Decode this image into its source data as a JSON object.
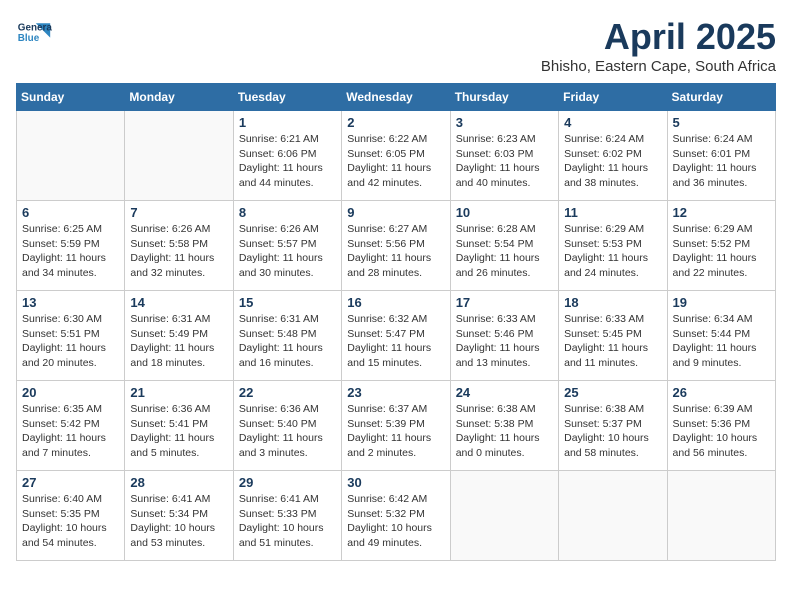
{
  "header": {
    "logo_general": "General",
    "logo_blue": "Blue",
    "month_title": "April 2025",
    "location": "Bhisho, Eastern Cape, South Africa"
  },
  "days_of_week": [
    "Sunday",
    "Monday",
    "Tuesday",
    "Wednesday",
    "Thursday",
    "Friday",
    "Saturday"
  ],
  "weeks": [
    [
      {
        "day": "",
        "info": ""
      },
      {
        "day": "",
        "info": ""
      },
      {
        "day": "1",
        "info": "Sunrise: 6:21 AM\nSunset: 6:06 PM\nDaylight: 11 hours and 44 minutes."
      },
      {
        "day": "2",
        "info": "Sunrise: 6:22 AM\nSunset: 6:05 PM\nDaylight: 11 hours and 42 minutes."
      },
      {
        "day": "3",
        "info": "Sunrise: 6:23 AM\nSunset: 6:03 PM\nDaylight: 11 hours and 40 minutes."
      },
      {
        "day": "4",
        "info": "Sunrise: 6:24 AM\nSunset: 6:02 PM\nDaylight: 11 hours and 38 minutes."
      },
      {
        "day": "5",
        "info": "Sunrise: 6:24 AM\nSunset: 6:01 PM\nDaylight: 11 hours and 36 minutes."
      }
    ],
    [
      {
        "day": "6",
        "info": "Sunrise: 6:25 AM\nSunset: 5:59 PM\nDaylight: 11 hours and 34 minutes."
      },
      {
        "day": "7",
        "info": "Sunrise: 6:26 AM\nSunset: 5:58 PM\nDaylight: 11 hours and 32 minutes."
      },
      {
        "day": "8",
        "info": "Sunrise: 6:26 AM\nSunset: 5:57 PM\nDaylight: 11 hours and 30 minutes."
      },
      {
        "day": "9",
        "info": "Sunrise: 6:27 AM\nSunset: 5:56 PM\nDaylight: 11 hours and 28 minutes."
      },
      {
        "day": "10",
        "info": "Sunrise: 6:28 AM\nSunset: 5:54 PM\nDaylight: 11 hours and 26 minutes."
      },
      {
        "day": "11",
        "info": "Sunrise: 6:29 AM\nSunset: 5:53 PM\nDaylight: 11 hours and 24 minutes."
      },
      {
        "day": "12",
        "info": "Sunrise: 6:29 AM\nSunset: 5:52 PM\nDaylight: 11 hours and 22 minutes."
      }
    ],
    [
      {
        "day": "13",
        "info": "Sunrise: 6:30 AM\nSunset: 5:51 PM\nDaylight: 11 hours and 20 minutes."
      },
      {
        "day": "14",
        "info": "Sunrise: 6:31 AM\nSunset: 5:49 PM\nDaylight: 11 hours and 18 minutes."
      },
      {
        "day": "15",
        "info": "Sunrise: 6:31 AM\nSunset: 5:48 PM\nDaylight: 11 hours and 16 minutes."
      },
      {
        "day": "16",
        "info": "Sunrise: 6:32 AM\nSunset: 5:47 PM\nDaylight: 11 hours and 15 minutes."
      },
      {
        "day": "17",
        "info": "Sunrise: 6:33 AM\nSunset: 5:46 PM\nDaylight: 11 hours and 13 minutes."
      },
      {
        "day": "18",
        "info": "Sunrise: 6:33 AM\nSunset: 5:45 PM\nDaylight: 11 hours and 11 minutes."
      },
      {
        "day": "19",
        "info": "Sunrise: 6:34 AM\nSunset: 5:44 PM\nDaylight: 11 hours and 9 minutes."
      }
    ],
    [
      {
        "day": "20",
        "info": "Sunrise: 6:35 AM\nSunset: 5:42 PM\nDaylight: 11 hours and 7 minutes."
      },
      {
        "day": "21",
        "info": "Sunrise: 6:36 AM\nSunset: 5:41 PM\nDaylight: 11 hours and 5 minutes."
      },
      {
        "day": "22",
        "info": "Sunrise: 6:36 AM\nSunset: 5:40 PM\nDaylight: 11 hours and 3 minutes."
      },
      {
        "day": "23",
        "info": "Sunrise: 6:37 AM\nSunset: 5:39 PM\nDaylight: 11 hours and 2 minutes."
      },
      {
        "day": "24",
        "info": "Sunrise: 6:38 AM\nSunset: 5:38 PM\nDaylight: 11 hours and 0 minutes."
      },
      {
        "day": "25",
        "info": "Sunrise: 6:38 AM\nSunset: 5:37 PM\nDaylight: 10 hours and 58 minutes."
      },
      {
        "day": "26",
        "info": "Sunrise: 6:39 AM\nSunset: 5:36 PM\nDaylight: 10 hours and 56 minutes."
      }
    ],
    [
      {
        "day": "27",
        "info": "Sunrise: 6:40 AM\nSunset: 5:35 PM\nDaylight: 10 hours and 54 minutes."
      },
      {
        "day": "28",
        "info": "Sunrise: 6:41 AM\nSunset: 5:34 PM\nDaylight: 10 hours and 53 minutes."
      },
      {
        "day": "29",
        "info": "Sunrise: 6:41 AM\nSunset: 5:33 PM\nDaylight: 10 hours and 51 minutes."
      },
      {
        "day": "30",
        "info": "Sunrise: 6:42 AM\nSunset: 5:32 PM\nDaylight: 10 hours and 49 minutes."
      },
      {
        "day": "",
        "info": ""
      },
      {
        "day": "",
        "info": ""
      },
      {
        "day": "",
        "info": ""
      }
    ]
  ]
}
